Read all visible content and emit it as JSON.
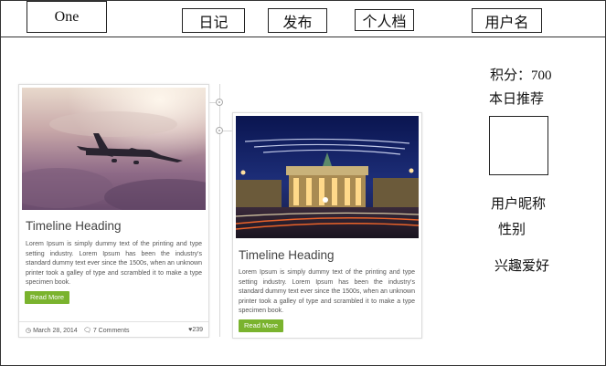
{
  "nav": {
    "brand": "One",
    "diary": "日记",
    "publish": "发布",
    "profile": "个人档",
    "username": "用户名"
  },
  "timeline": {
    "posts": [
      {
        "heading": "Timeline Heading",
        "body": "Lorem Ipsum is simply dummy text of the printing and type setting industry. Lorem Ipsum has been the industry's standard dummy text ever since the 1500s, when an unknown printer took a galley of type and scrambled it to make a type specimen book.",
        "button": "Read More",
        "date": "March 28, 2014",
        "comments": "7 Comments",
        "likes": "239"
      },
      {
        "heading": "Timeline Heading",
        "body": "Lorem Ipsum is simply dummy text of the printing and type setting industry. Lorem Ipsum has been the industry's standard dummy text ever since the 1500s, when an unknown printer took a galley of type and scrambled it to make a type specimen book.",
        "button": "Read More"
      }
    ]
  },
  "sidebar": {
    "points": "积分：700",
    "daily_recommend": "本日推荐",
    "nickname": "用户昵称",
    "gender": "性别",
    "hobbies": "兴趣爱好"
  },
  "colors": {
    "accent_button": "#7ab32e",
    "border": "#333333"
  },
  "icons": [
    "clock-icon",
    "comments-icon",
    "heart-icon",
    "timeline-node-icon"
  ]
}
